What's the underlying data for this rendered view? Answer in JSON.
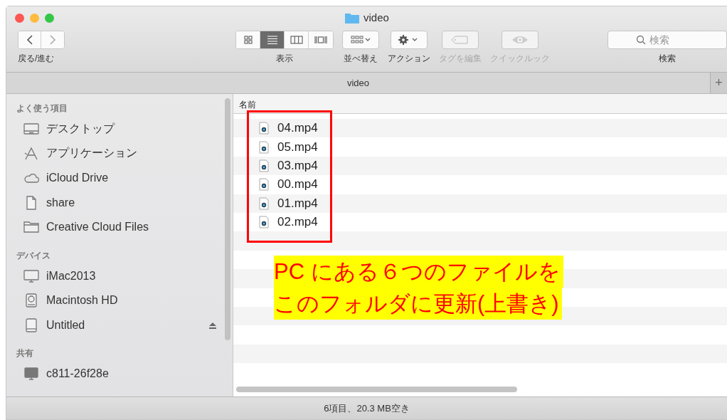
{
  "window": {
    "title": "video"
  },
  "toolbar": {
    "nav_label": "戻る/進む",
    "view_modes": [
      {
        "kind": "icons",
        "selected": false
      },
      {
        "kind": "list",
        "selected": true
      },
      {
        "kind": "columns",
        "selected": false
      },
      {
        "kind": "coverflow",
        "selected": false
      }
    ],
    "view_label": "表示",
    "actions": [
      {
        "kind": "sort",
        "label": "並べ替え",
        "disabled": false
      },
      {
        "kind": "gear",
        "label": "アクション",
        "disabled": false
      },
      {
        "kind": "tag",
        "label": "タグを編集",
        "disabled": true
      },
      {
        "kind": "eye",
        "label": "クイックルック",
        "disabled": true
      }
    ],
    "search": {
      "placeholder": "検索",
      "label": "検索"
    }
  },
  "tab_bar": {
    "tab": "video",
    "add": "+"
  },
  "sidebar": {
    "sections": [
      {
        "title": "よく使う項目",
        "items": [
          {
            "kind": "desktop",
            "label": "デスクトップ"
          },
          {
            "kind": "apps",
            "label": "アプリケーション"
          },
          {
            "kind": "cloud",
            "label": "iCloud Drive"
          },
          {
            "kind": "doc",
            "label": "share"
          },
          {
            "kind": "folder",
            "label": "Creative Cloud Files"
          }
        ]
      },
      {
        "title": "デバイス",
        "items": [
          {
            "kind": "imac",
            "label": "iMac2013"
          },
          {
            "kind": "hd",
            "label": "Macintosh HD"
          },
          {
            "kind": "drive",
            "label": "Untitled",
            "eject": true
          }
        ]
      },
      {
        "title": "共有",
        "items": [
          {
            "kind": "server",
            "label": "c811-26f28e"
          }
        ]
      }
    ]
  },
  "table": {
    "columns": [
      "名前"
    ],
    "rows": [
      "04.mp4",
      "05.mp4",
      "03.mp4",
      "00.mp4",
      "01.mp4",
      "02.mp4"
    ]
  },
  "annotation": {
    "lines": [
      "PC にある６つのファイルを",
      "このフォルダに更新(上書き)"
    ]
  },
  "status_bar": "6項目、20.3 MB空き"
}
